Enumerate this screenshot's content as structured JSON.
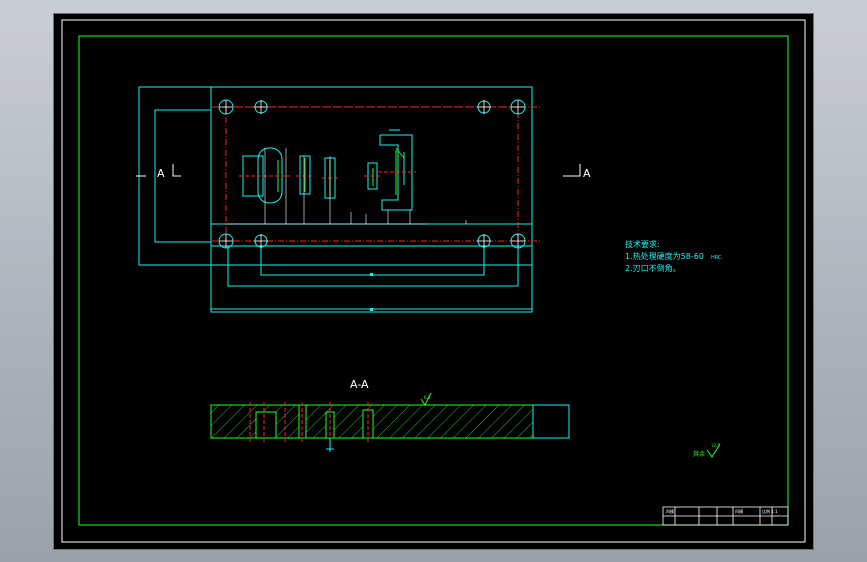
{
  "section_markers": {
    "left": "A",
    "right": "A",
    "section_title": "A-A"
  },
  "technical_requirements": {
    "heading": "技术要求:",
    "line1": "1.热处理硬度为58-60",
    "line1_unit": "HRC.",
    "line2": "2.刃口不倒角。"
  },
  "roughness": {
    "section_value": "6.3",
    "other_label": "其余",
    "other_value": "12.5"
  },
  "title_block": {
    "left_label": "凹模",
    "middle_label": "凹模",
    "right_label": "比例 1:1"
  },
  "colors": {
    "background": "#000000",
    "frame": "#ffffff",
    "border": "#20ff20",
    "part": "#20ff20",
    "detail": "#19f0f0",
    "centerline": "#ff2020",
    "text_white": "#ffffff",
    "text_cyan": "#19f0f0"
  }
}
